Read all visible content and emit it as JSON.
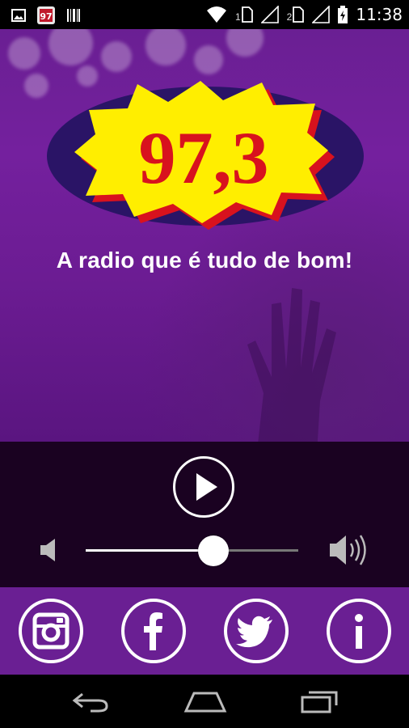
{
  "status_bar": {
    "icons": [
      "image-icon",
      "app-notification-icon",
      "barcode-icon",
      "wifi-icon",
      "sim1-icon",
      "signal1-icon",
      "sim2-icon",
      "signal2-icon",
      "battery-icon"
    ],
    "sim1_label": "1",
    "sim2_label": "2",
    "time": "11:38"
  },
  "logo": {
    "frequency": "97,3",
    "colors": {
      "oval": "#2a1466",
      "star": "#ffee00",
      "shadow": "#d8121e",
      "text": "#d8121e"
    }
  },
  "tagline": "A radio que é tudo de bom!",
  "player": {
    "play_icon": "play-icon",
    "volume_low_icon": "speaker-mute-icon",
    "volume_high_icon": "speaker-loud-icon",
    "volume_level": 0.6
  },
  "social": [
    {
      "name": "instagram",
      "icon": "instagram-icon"
    },
    {
      "name": "facebook",
      "icon": "facebook-icon"
    },
    {
      "name": "twitter",
      "icon": "twitter-icon"
    },
    {
      "name": "info",
      "icon": "info-icon"
    }
  ],
  "nav": [
    "back-icon",
    "home-icon",
    "recents-icon"
  ],
  "colors": {
    "purple": "#6a1f93",
    "player_bg": "#1a0221",
    "white": "#ffffff"
  }
}
